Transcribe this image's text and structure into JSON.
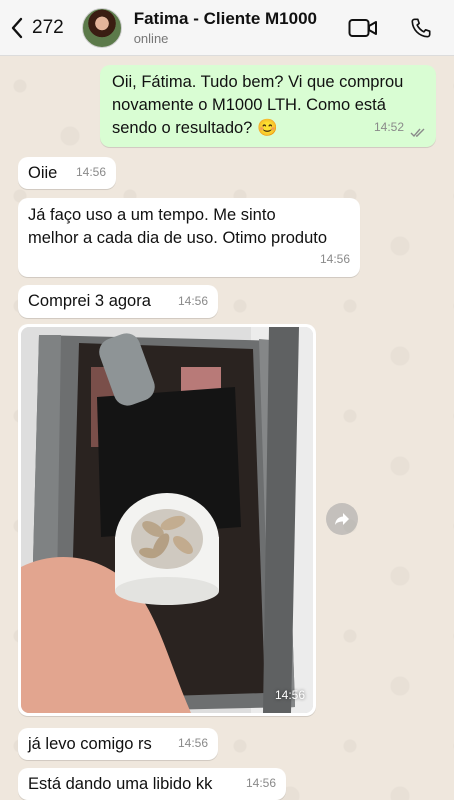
{
  "header": {
    "back_count": "272",
    "contact_name": "Fatima - Cliente M1000",
    "contact_status": "online"
  },
  "messages": [
    {
      "text": "Oii, Fátima. Tudo bem? Vi que comprou novamente o M1000 LTH. Como está sendo o resultado? 😊",
      "time": "14:52",
      "direction": "outgoing",
      "read": true
    },
    {
      "text": "Oiie",
      "time": "14:56",
      "direction": "incoming"
    },
    {
      "text": "Já faço uso a um tempo. Me sinto melhor a cada dia de uso. Otimo produto",
      "time": "14:56",
      "direction": "incoming"
    },
    {
      "text": "Comprei 3 agora",
      "time": "14:56",
      "direction": "incoming"
    },
    {
      "time": "14:56",
      "direction": "incoming",
      "type": "image"
    },
    {
      "text": "já levo comigo rs",
      "time": "14:56",
      "direction": "incoming"
    },
    {
      "text": "Está dando uma libido kk",
      "time": "14:56",
      "direction": "incoming"
    }
  ],
  "colors": {
    "outgoing_bubble": "#d9fdd3",
    "incoming_bubble": "#ffffff",
    "chat_background": "#efe7dd",
    "read_ticks": "#8a8a8a"
  },
  "icons": [
    "chevron-left-icon",
    "video-call-icon",
    "phone-icon",
    "read-ticks-icon",
    "forward-icon"
  ]
}
